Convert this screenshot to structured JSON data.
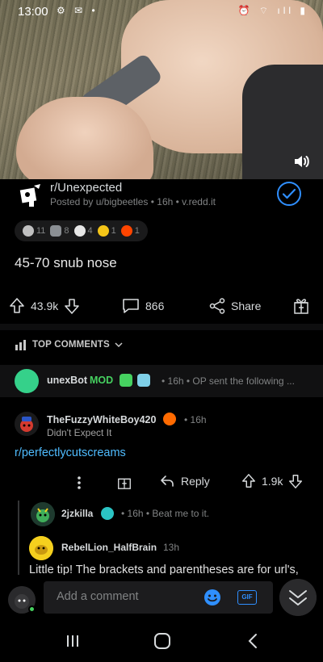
{
  "status_bar": {
    "time": "13:00",
    "left_icons": "⚙ ✉ •",
    "right_icons": "⏰ ⌔ ıll ▮"
  },
  "post": {
    "subreddit": "r/Unexpected",
    "meta": "Posted by u/bigbeetles • 16h • v.redd.it",
    "awards": [
      {
        "icon": "silver-award-icon",
        "count": "11",
        "color": "#c0c0c0"
      },
      {
        "icon": "helpful-award-icon",
        "count": "8",
        "color": "#9aa0a6"
      },
      {
        "icon": "wholesome-award-icon",
        "count": "4",
        "color": "#e6e6e6"
      },
      {
        "icon": "laugh-award-icon",
        "count": "1",
        "color": "#f5c518"
      },
      {
        "icon": "snoo-award-icon",
        "count": "1",
        "color": "#ff4500"
      }
    ],
    "title": "45-70 snub nose",
    "upvotes": "43.9k",
    "comments": "866",
    "share": "Share"
  },
  "top_comments_label": "TOP COMMENTS",
  "bot_comment": {
    "author": "unexBot",
    "mod": "MOD",
    "meta": "• 16h • OP sent the following ..."
  },
  "comment": {
    "author": "TheFuzzyWhiteBoy420",
    "time": "• 16h",
    "flair": "Didn't Expect It",
    "body": "r/perfectlycutscreams",
    "reply": "Reply",
    "score": "1.9k"
  },
  "reply1": {
    "author": "2jzkilla",
    "meta": "• 16h • Beat me to it."
  },
  "reply2": {
    "author": "RebelLion_HalfBrain",
    "time": "13h",
    "body": "Little tip! The brackets and parentheses are for url's,"
  },
  "composer": {
    "placeholder": "Add a comment",
    "gif": "GIF"
  },
  "colors": {
    "accent": "#2f8fff",
    "link": "#4fbcff",
    "mod": "#46d160"
  }
}
